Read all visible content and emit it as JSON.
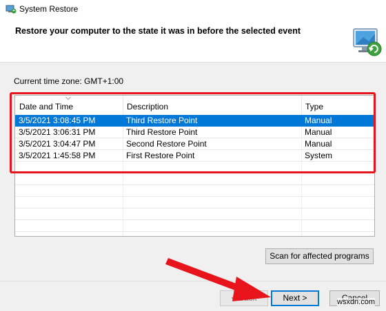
{
  "window": {
    "title": "System Restore",
    "icon": "system-restore-icon"
  },
  "header": {
    "text": "Restore your computer to the state it was in before the selected event",
    "icon": "computer-restore-icon"
  },
  "timezone": {
    "label": "Current time zone: GMT+1:00"
  },
  "list": {
    "columns": [
      "Date and Time",
      "Description",
      "Type"
    ],
    "sorted_column": "Date and Time",
    "rows": [
      {
        "date": "3/5/2021 3:08:45 PM",
        "description": "Third Restore Point",
        "type": "Manual",
        "selected": true
      },
      {
        "date": "3/5/2021 3:06:31 PM",
        "description": "Third Restore Point",
        "type": "Manual",
        "selected": false
      },
      {
        "date": "3/5/2021 3:04:47 PM",
        "description": "Second Restore Point",
        "type": "Manual",
        "selected": false
      },
      {
        "date": "3/5/2021 1:45:58 PM",
        "description": "First Restore Point",
        "type": "System",
        "selected": false
      }
    ]
  },
  "buttons": {
    "scan": "Scan for affected programs",
    "back": "< Back",
    "next": "Next >",
    "cancel": "Cancel"
  },
  "annotations": {
    "highlight_color": "#e8141b",
    "arrow_color": "#e8141b"
  },
  "selection_color": "#0078d7",
  "watermark": "wsxdn.com"
}
